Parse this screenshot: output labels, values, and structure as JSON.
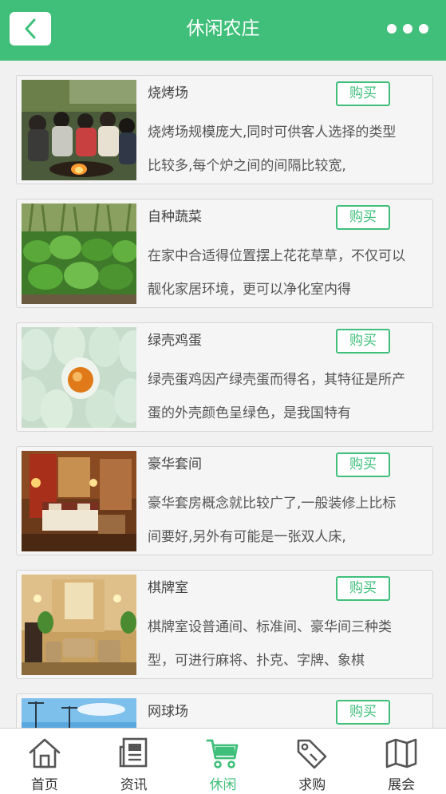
{
  "header": {
    "title": "休闲农庄",
    "back_icon": "chevron-left-icon",
    "more_icon": "more-dots-icon",
    "accent_color": "#3fbf7a"
  },
  "items": [
    {
      "name": "烧烤场",
      "buy_label": "购买",
      "description": "烧烤场规模庞大,同时可供客人选择的类型比较多,每个炉之间的间隔比较宽,"
    },
    {
      "name": "自种蔬菜",
      "buy_label": "购买",
      "description": "在家中合适得位置摆上花花草草，不仅可以靓化家居环境，更可以净化室内得"
    },
    {
      "name": "绿壳鸡蛋",
      "buy_label": "购买",
      "description": "绿壳蛋鸡因产绿壳蛋而得名，其特征是所产蛋的外壳颜色呈绿色，是我国特有"
    },
    {
      "name": "豪华套间",
      "buy_label": "购买",
      "description": "豪华套房概念就比较广了,一般装修上比标间要好,另外有可能是一张双人床,"
    },
    {
      "name": "棋牌室",
      "buy_label": "购买",
      "description": "棋牌室设普通间、标准间、豪华间三种类型，可进行麻将、扑克、字牌、象棋"
    },
    {
      "name": "网球场",
      "buy_label": "购买",
      "description": ""
    }
  ],
  "tabs": [
    {
      "label": "首页",
      "icon": "home-icon",
      "active": false
    },
    {
      "label": "资讯",
      "icon": "news-icon",
      "active": false
    },
    {
      "label": "休闲",
      "icon": "cart-icon",
      "active": true
    },
    {
      "label": "求购",
      "icon": "tag-icon",
      "active": false
    },
    {
      "label": "展会",
      "icon": "map-icon",
      "active": false
    }
  ]
}
